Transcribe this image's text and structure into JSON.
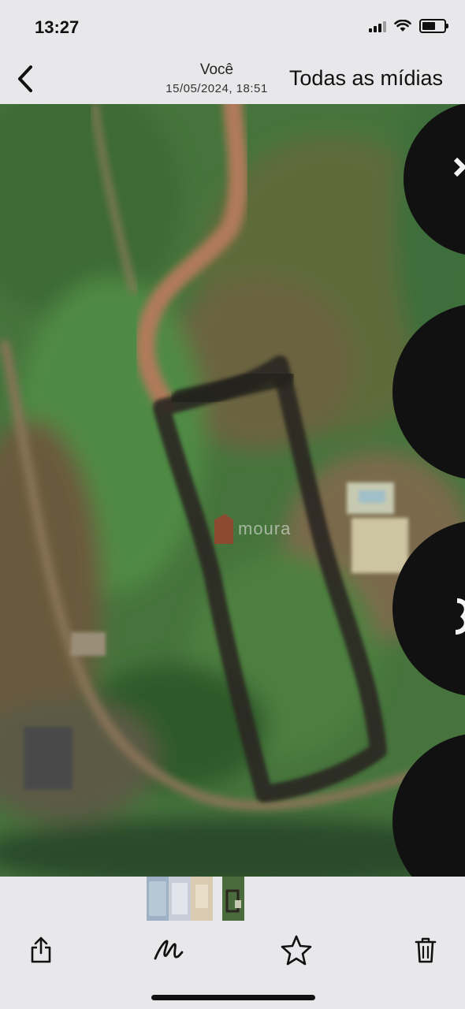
{
  "status_bar": {
    "time": "13:27"
  },
  "nav": {
    "back_icon": "chevron-left-icon",
    "title": "Você",
    "subtitle": "15/05/2024, 18:51",
    "all_media_label": "Todas as mídias"
  },
  "photo": {
    "description_free": true,
    "watermark_text": "moura",
    "watermark_color": "#c62828"
  },
  "toolbar": {
    "icons": [
      "share-icon",
      "markup-icon",
      "favorite-star-icon",
      "trash-icon"
    ]
  },
  "colors": {
    "bar_background": "#e8e8ea",
    "text": "#111111"
  }
}
